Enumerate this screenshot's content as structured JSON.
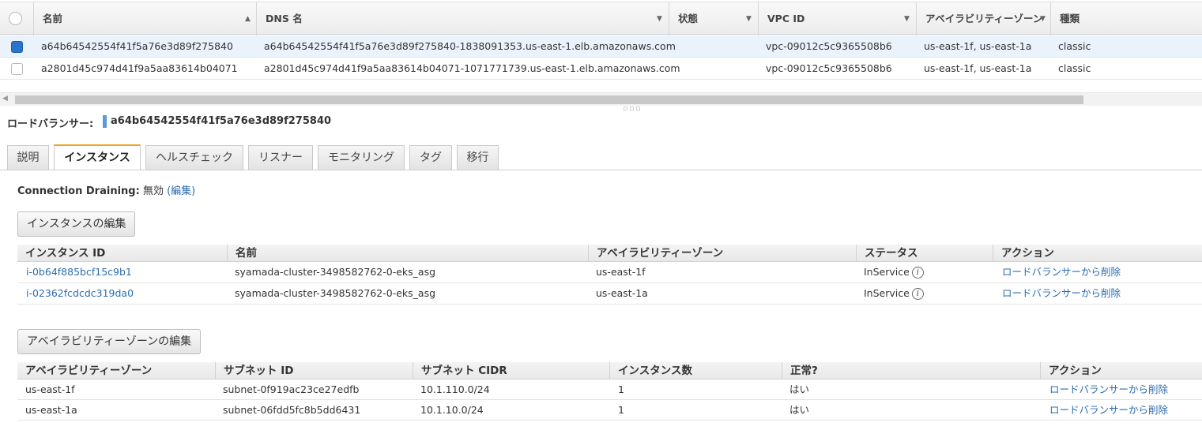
{
  "lb_table": {
    "columns": [
      "名前",
      "DNS 名",
      "状態",
      "VPC ID",
      "アベイラビリティーゾーン",
      "種類"
    ],
    "rows": [
      {
        "name": "a64b64542554f41f5a76e3d89f275840",
        "dns": "a64b64542554f41f5a76e3d89f275840-1838091353.us-east-1.elb.amazonaws.com",
        "state": "",
        "vpc": "vpc-09012c5c9365508b6",
        "az": "us-east-1f, us-east-1a",
        "type": "classic",
        "selected": true
      },
      {
        "name": "a2801d45c974d41f9a5aa83614b04071",
        "dns": "a2801d45c974d41f9a5aa83614b04071-1071771739.us-east-1.elb.amazonaws.com",
        "state": "",
        "vpc": "vpc-09012c5c9365508b6",
        "az": "us-east-1f, us-east-1a",
        "type": "classic",
        "selected": false
      }
    ]
  },
  "detail": {
    "label": "ロードバランサー:",
    "name": "a64b64542554f41f5a76e3d89f275840"
  },
  "tabs": [
    "説明",
    "インスタンス",
    "ヘルスチェック",
    "リスナー",
    "モニタリング",
    "タグ",
    "移行"
  ],
  "active_tab": "インスタンス",
  "draining": {
    "label": "Connection Draining:",
    "value": "無効",
    "edit": "(編集)"
  },
  "instances": {
    "edit_button": "インスタンスの編集",
    "columns": [
      "インスタンス ID",
      "名前",
      "アベイラビリティーゾーン",
      "ステータス",
      "アクション"
    ],
    "rows": [
      {
        "id": "i-0b64f885bcf15c9b1",
        "name": "syamada-cluster-3498582762-0-eks_asg",
        "az": "us-east-1f",
        "status": "InService",
        "action": "ロードバランサーから削除"
      },
      {
        "id": "i-02362fcdcdc319da0",
        "name": "syamada-cluster-3498582762-0-eks_asg",
        "az": "us-east-1a",
        "status": "InService",
        "action": "ロードバランサーから削除"
      }
    ]
  },
  "zones": {
    "edit_button": "アベイラビリティーゾーンの編集",
    "columns": [
      "アベイラビリティーゾーン",
      "サブネット ID",
      "サブネット CIDR",
      "インスタンス数",
      "正常?",
      "アクション"
    ],
    "rows": [
      {
        "az": "us-east-1f",
        "subnet": "subnet-0f919ac23ce27edfb",
        "cidr": "10.1.110.0/24",
        "count": "1",
        "healthy": "はい",
        "action": "ロードバランサーから削除"
      },
      {
        "az": "us-east-1a",
        "subnet": "subnet-06fdd5fc8b5dd6431",
        "cidr": "10.1.10.0/24",
        "count": "1",
        "healthy": "はい",
        "action": "ロードバランサーから削除"
      }
    ]
  },
  "icons": {
    "info": "info-icon",
    "sort": "sort-asc-icon",
    "dropdown": "chevron-down-icon"
  },
  "colors": {
    "accent_tab": "#f0a31f",
    "link": "#2b6cb0",
    "selected_row": "#eaf3fb",
    "checkbox": "#2b74c8"
  }
}
